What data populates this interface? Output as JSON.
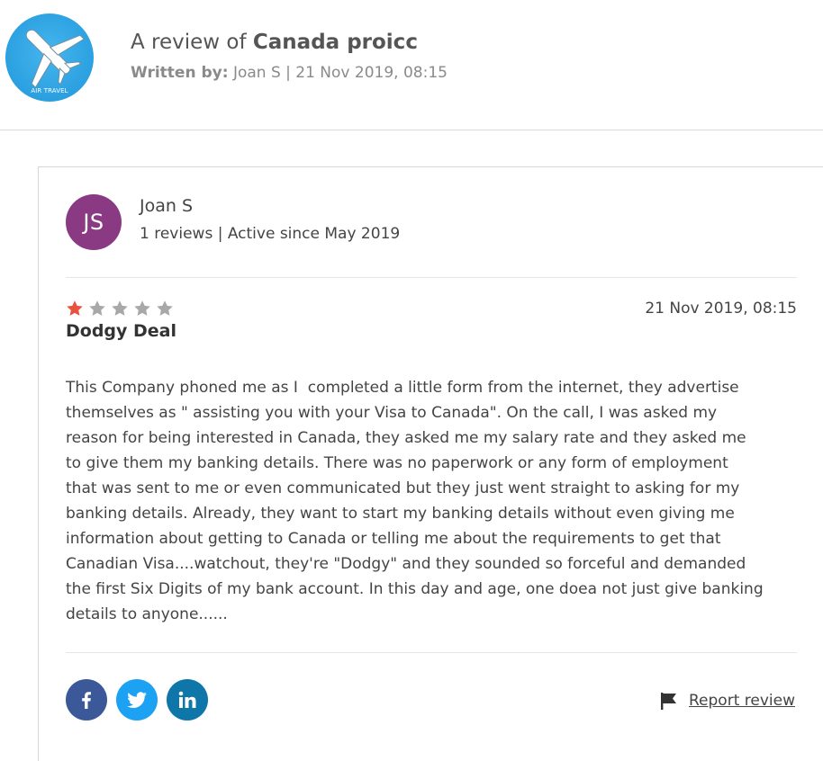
{
  "header": {
    "logo_text": "AIR TRAVEL",
    "title_prefix": "A review of",
    "company_name": "Canada proicc",
    "written_by_label": "Written by:",
    "written_by_value": "Joan S | 21 Nov 2019, 08:15"
  },
  "reviewer": {
    "initials": "JS",
    "name": "Joan S",
    "meta": "1 reviews | Active since May 2019"
  },
  "review": {
    "rating": 1,
    "max_rating": 5,
    "date": "21 Nov 2019, 08:15",
    "title": "Dodgy Deal",
    "body_lines": [
      "This Company phoned me as I  completed a little form from the internet, they advertise",
      "themselves as \" assisting you with your Visa to Canada\". On the call, I was asked my",
      "reason for being interested in Canada, they asked me my salary rate and they asked me",
      "to give them my banking details. There was no paperwork or any form of employment",
      "that was sent to me or even communicated but they just went straight to asking for my",
      "banking details. Already, they want to start my banking details without even giving me",
      "information about getting to Canada or telling me about the requirements to get that",
      "Canadian Visa....watchout, they're \"Dodgy\" and they sounded so forceful and demanded",
      "the first Six Digits of my bank account. In this day and age, one doea not just give banking",
      "details to anyone......"
    ]
  },
  "share": {
    "icons": [
      "facebook-icon",
      "twitter-icon",
      "linkedin-icon"
    ]
  },
  "report": {
    "label": "Report review",
    "icon": "flag-icon"
  },
  "colors": {
    "avatar_bg": "#8a3a83",
    "star_active": "#e8533d",
    "star_inactive": "#a8a8a8",
    "facebook": "#3b5998",
    "twitter": "#1da1f2",
    "linkedin": "#0e76a8"
  }
}
